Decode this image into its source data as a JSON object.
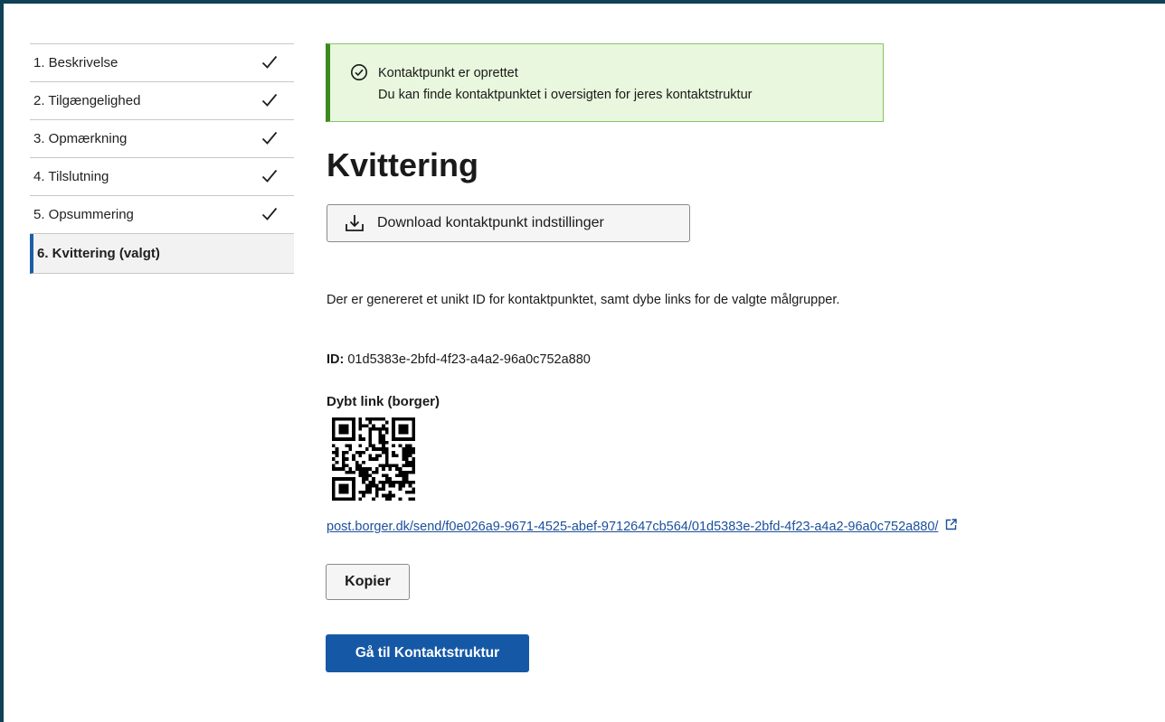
{
  "steps": [
    {
      "label": "1. Beskrivelse",
      "done": true
    },
    {
      "label": "2. Tilgængelighed",
      "done": true
    },
    {
      "label": "3. Opmærkning",
      "done": true
    },
    {
      "label": "4. Tilslutning",
      "done": true
    },
    {
      "label": "5. Opsummering",
      "done": true
    },
    {
      "label": "6. Kvittering (valgt)",
      "done": false,
      "active": true
    }
  ],
  "alert": {
    "title": "Kontaktpunkt er oprettet",
    "message": "Du kan finde kontaktpunktet i oversigten for jeres kontaktstruktur"
  },
  "page_title": "Kvittering",
  "download_button": "Download kontaktpunkt indstillinger",
  "description": "Der er genereret et unikt ID for kontaktpunktet, samt dybe links for de valgte målgrupper.",
  "id_label": "ID:",
  "id_value": " 01d5383e-2bfd-4f23-a4a2-96a0c752a880",
  "deep_link_heading": "Dybt link (borger)",
  "deep_link_url": "post.borger.dk/send/f0e026a9-9671-4525-abef-9712647cb564/01d5383e-2bfd-4f23-a4a2-96a0c752a880/",
  "copy_button": "Kopier",
  "primary_button": "Gå til Kontaktstruktur",
  "colors": {
    "accent": "#1559a6",
    "success_bg": "#e8f7dd",
    "success_border": "#3b8a1e",
    "frame": "#0f4255"
  }
}
